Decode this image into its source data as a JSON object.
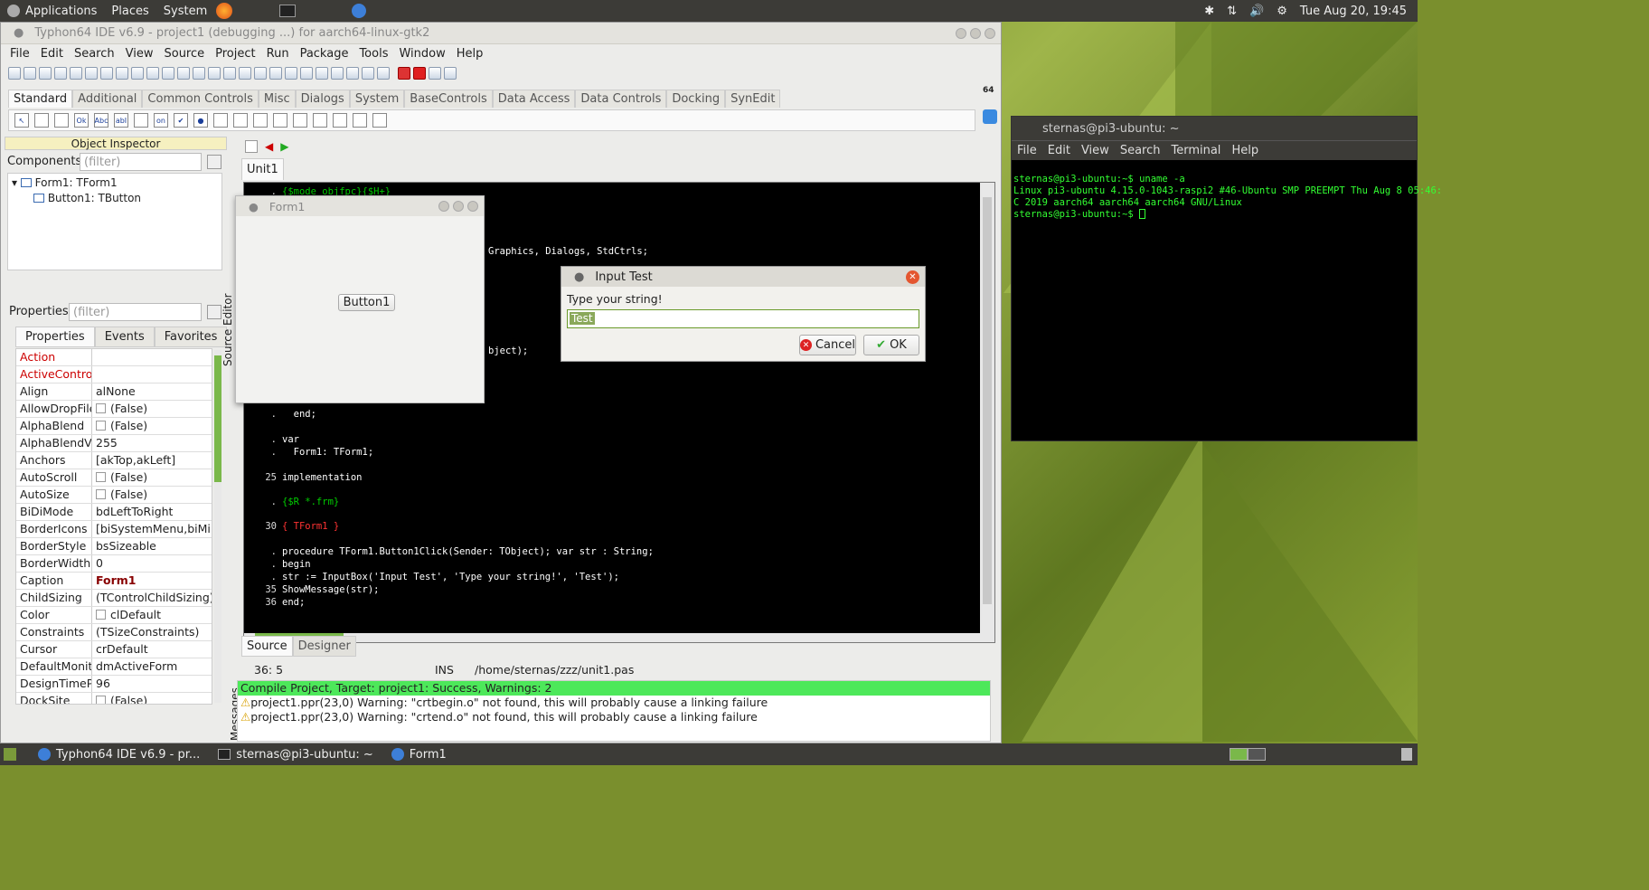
{
  "top_panel": {
    "menus": [
      "Applications",
      "Places",
      "System"
    ],
    "clock": "Tue Aug 20, 19:45"
  },
  "ide": {
    "title": "Typhon64 IDE v6.9 - project1 (debugging ...) for aarch64-linux-gtk2",
    "menu": [
      "File",
      "Edit",
      "Search",
      "View",
      "Source",
      "Project",
      "Run",
      "Package",
      "Tools",
      "Window",
      "Help"
    ],
    "palette_tabs": [
      "Standard",
      "Additional",
      "Common Controls",
      "Misc",
      "Dialogs",
      "System",
      "BaseControls",
      "Data Access",
      "Data Controls",
      "Docking",
      "SynEdit"
    ],
    "palette_icons": [
      "Ok",
      "Abc",
      "abI",
      "on"
    ],
    "palette_badge": "64",
    "source_tab": "Unit1",
    "bottom_tabs": [
      "Source",
      "Designer"
    ],
    "status": {
      "pos": "36:  5",
      "mode": "INS",
      "file": "/home/sternas/zzz/unit1.pas"
    },
    "source_editor_label": "Source Editor",
    "messages_label": "Messages"
  },
  "object_inspector": {
    "title": "Object Inspector",
    "components_label": "Components",
    "filter_placeholder": "(filter)",
    "tree": [
      "Form1: TForm1",
      "Button1: TButton"
    ],
    "properties_label": "Properties",
    "tabs": [
      "Properties",
      "Events",
      "Favorites"
    ],
    "props": [
      {
        "name": "Action",
        "value": "",
        "nameRed": true
      },
      {
        "name": "ActiveControl",
        "value": "",
        "nameRed": true
      },
      {
        "name": "Align",
        "value": "alNone"
      },
      {
        "name": "AllowDropFile",
        "value": "(False)",
        "check": true
      },
      {
        "name": "AlphaBlend",
        "value": "(False)",
        "check": true
      },
      {
        "name": "AlphaBlendVa",
        "value": "255"
      },
      {
        "name": "Anchors",
        "value": "[akTop,akLeft]",
        "exp": true
      },
      {
        "name": "AutoScroll",
        "value": "(False)",
        "check": true
      },
      {
        "name": "AutoSize",
        "value": "(False)",
        "check": true
      },
      {
        "name": "BiDiMode",
        "value": "bdLeftToRight"
      },
      {
        "name": "BorderIcons",
        "value": "[biSystemMenu,biMini",
        "exp": true
      },
      {
        "name": "BorderStyle",
        "value": "bsSizeable"
      },
      {
        "name": "BorderWidth",
        "value": "0"
      },
      {
        "name": "Caption",
        "value": "Form1",
        "bold": true
      },
      {
        "name": "ChildSizing",
        "value": "(TControlChildSizing)",
        "exp": true
      },
      {
        "name": "Color",
        "value": "clDefault",
        "check": true
      },
      {
        "name": "Constraints",
        "value": "(TSizeConstraints)",
        "exp": true
      },
      {
        "name": "Cursor",
        "value": "crDefault"
      },
      {
        "name": "DefaultMonito",
        "value": "dmActiveForm"
      },
      {
        "name": "DesignTimePP",
        "value": "96"
      },
      {
        "name": "DockSite",
        "value": "(False)",
        "check": true
      }
    ]
  },
  "code": {
    "lines": [
      {
        "g": ".",
        "t": "{$mode objfpc}{$H+}",
        "c": "grn"
      },
      {
        "g": "",
        "t": "Graphics, Dialogs, StdCtrls;",
        "c": "kw",
        "indent": 228
      },
      {
        "g": "",
        "t": "bject);",
        "c": "kw",
        "indent": 228
      },
      {
        "g": ".",
        "t": "  end;",
        "c": "kw"
      },
      {
        "g": ".",
        "t": "var",
        "c": "kw"
      },
      {
        "g": ".",
        "t": "  Form1: TForm1;",
        "c": "kw"
      },
      {
        "g": "25",
        "t": "implementation",
        "c": "kw"
      },
      {
        "g": ".",
        "t": "{$R *.frm}",
        "c": "grn"
      },
      {
        "g": "30",
        "t": "{ TForm1 }",
        "c": "red"
      },
      {
        "g": ".",
        "t": "procedure TForm1.Button1Click(Sender: TObject); var str : String;",
        "c": "kw"
      },
      {
        "g": ".",
        "t": "begin",
        "c": "kw"
      },
      {
        "g": ".",
        "t": "str := InputBox('Input Test', 'Type your string!', 'Test');",
        "c": "kw"
      },
      {
        "g": "35",
        "t": "ShowMessage(str);",
        "c": "kw"
      },
      {
        "g": "36",
        "t": "end;",
        "c": "kw"
      }
    ]
  },
  "form1": {
    "title": "Form1",
    "button": "Button1"
  },
  "input_dialog": {
    "title": "Input Test",
    "prompt": "Type your string!",
    "value": "Test",
    "cancel": "Cancel",
    "ok": "OK"
  },
  "messages": {
    "header": "Compile Project, Target: project1: Success, Warnings: 2",
    "items": [
      "project1.ppr(23,0) Warning: \"crtbegin.o\" not found, this will probably cause a linking failure",
      "project1.ppr(23,0) Warning: \"crtend.o\" not found, this will probably cause a linking failure"
    ]
  },
  "terminal": {
    "title": "sternas@pi3-ubuntu: ~",
    "menu": [
      "File",
      "Edit",
      "View",
      "Search",
      "Terminal",
      "Help"
    ],
    "lines": [
      "sternas@pi3-ubuntu:~$ uname -a",
      "Linux pi3-ubuntu 4.15.0-1043-raspi2 #46-Ubuntu SMP PREEMPT Thu Aug 8 05:46:",
      "C 2019 aarch64 aarch64 aarch64 GNU/Linux",
      "sternas@pi3-ubuntu:~$ "
    ]
  },
  "taskbar": [
    "Typhon64 IDE v6.9 - pr...",
    "sternas@pi3-ubuntu: ~",
    "Form1"
  ]
}
